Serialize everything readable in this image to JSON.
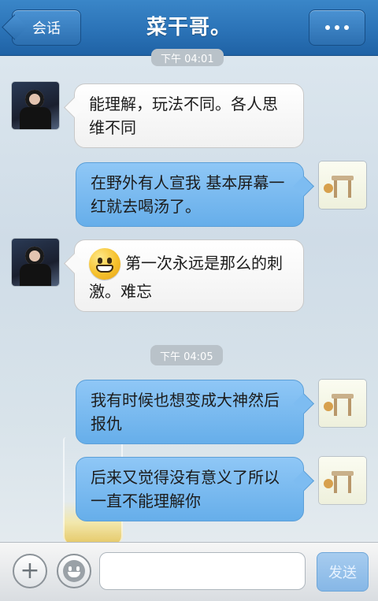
{
  "header": {
    "back_label": "会话",
    "title": "菜干哥。"
  },
  "timestamps": [
    "下午 04:01",
    "下午 04:05"
  ],
  "messages": [
    {
      "side": "left",
      "text": "能理解，玩法不同。各人思维不同"
    },
    {
      "side": "right",
      "text": "在野外有人宣我 基本屏幕一红就去喝汤了。"
    },
    {
      "side": "left",
      "text": "第一次永远是那么的刺激。难忘",
      "emoji": "grin-emoji"
    },
    {
      "side": "right",
      "text": "我有时候也想变成大神然后报仇"
    },
    {
      "side": "right",
      "text": "后来又觉得没有意义了所以一直不能理解你"
    }
  ],
  "composer": {
    "add_icon": "plus-icon",
    "emoji_icon": "smiley-icon",
    "input_value": "",
    "send_label": "发送"
  },
  "colors": {
    "header_blue": "#2b73b7",
    "bubble_right": "#7dbcf1",
    "bubble_left": "#ffffff"
  }
}
